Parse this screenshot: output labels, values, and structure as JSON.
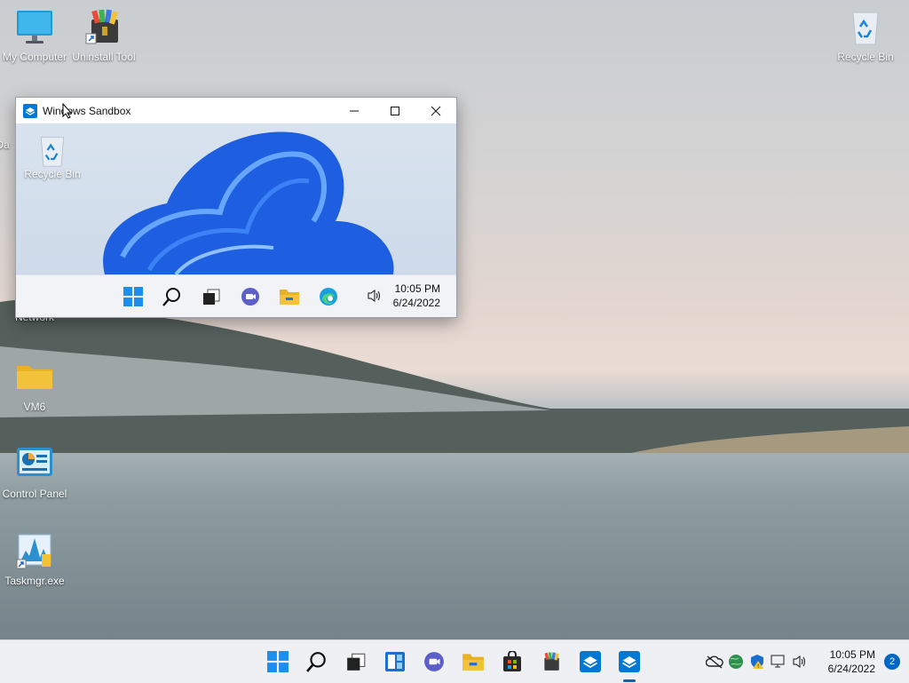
{
  "desktop": {
    "icons": [
      {
        "label": "My Computer",
        "icon": "monitor-icon"
      },
      {
        "label": "Uninstall Tool",
        "icon": "uninstall-tool-icon"
      },
      {
        "label": "Recycle Bin",
        "icon": "recycle-bin-icon"
      },
      {
        "label": "Network",
        "icon": "network-icon"
      },
      {
        "label": "VM6",
        "icon": "folder-icon"
      },
      {
        "label": "Control Panel",
        "icon": "control-panel-icon"
      },
      {
        "label": "Taskmgr.exe",
        "icon": "task-manager-icon"
      }
    ],
    "partial_label_da": "Da"
  },
  "sandbox_window": {
    "title": "Windows Sandbox",
    "controls": [
      "minimize-icon",
      "maximize-icon",
      "close-icon"
    ],
    "desktop_icon_label": "Recycle Bin",
    "taskbar_icons": [
      "start-icon",
      "search-icon",
      "task-view-icon",
      "chat-icon",
      "file-explorer-icon",
      "edge-icon"
    ],
    "tray": {
      "volume_icon": "volume-icon",
      "time": "10:05 PM",
      "date": "6/24/2022"
    }
  },
  "taskbar": {
    "icons": [
      "start-icon",
      "search-icon",
      "task-view-icon",
      "widgets-icon",
      "chat-icon",
      "file-explorer-icon",
      "store-icon",
      "winrar-icon",
      "sandbox-icon",
      "sandbox-active-icon"
    ],
    "tray_icons": [
      "onedrive-offline-icon",
      "network-globe-icon",
      "defender-shield-icon",
      "display-icon",
      "volume-icon"
    ],
    "time": "10:05 PM",
    "date": "6/24/2022",
    "notification_count": "2"
  },
  "colors": {
    "accent": "#0067c0",
    "windows_blue": "#0078d4",
    "folder_yellow": "#f3c23b"
  }
}
